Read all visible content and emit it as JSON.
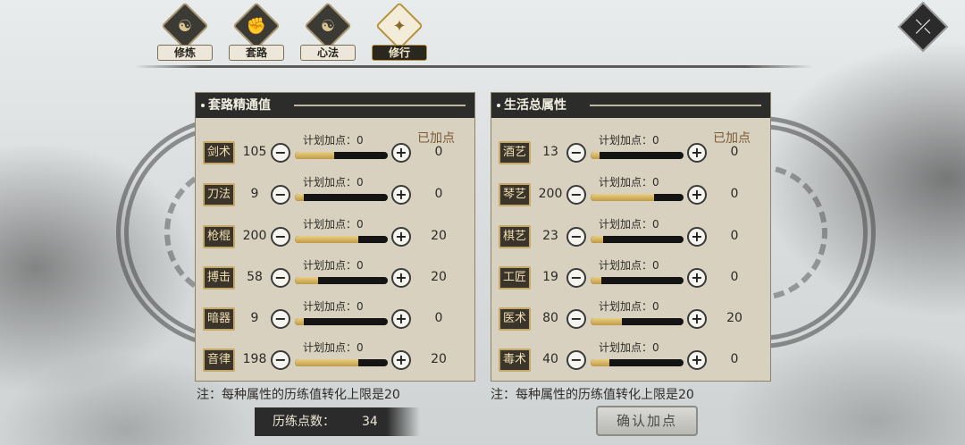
{
  "tabs": [
    {
      "label": "修炼",
      "icon": "cultivation-icon",
      "glyph": "☯",
      "active": false
    },
    {
      "label": "套路",
      "icon": "fist-icon",
      "glyph": "✊",
      "active": false
    },
    {
      "label": "心法",
      "icon": "taiji-icon",
      "glyph": "☯",
      "active": false
    },
    {
      "label": "修行",
      "icon": "practice-icon",
      "glyph": "✦",
      "active": true
    }
  ],
  "close_glyph": "⤫",
  "left_panel": {
    "title": "套路精通值",
    "added_header": "已加点",
    "plan_label": "计划加点：0",
    "rows": [
      {
        "name": "剑术",
        "value": "105",
        "added": "0",
        "fill": 0.42
      },
      {
        "name": "刀法",
        "value": "9",
        "added": "0",
        "fill": 0.1
      },
      {
        "name": "枪棍",
        "value": "200",
        "added": "20",
        "fill": 0.68
      },
      {
        "name": "搏击",
        "value": "58",
        "added": "20",
        "fill": 0.25
      },
      {
        "name": "暗器",
        "value": "9",
        "added": "0",
        "fill": 0.1
      },
      {
        "name": "音律",
        "value": "198",
        "added": "20",
        "fill": 0.68
      }
    ],
    "note": "注：每种属性的历练值转化上限是20"
  },
  "right_panel": {
    "title": "生活总属性",
    "added_header": "已加点",
    "plan_label": "计划加点：0",
    "rows": [
      {
        "name": "酒艺",
        "value": "13",
        "added": "0",
        "fill": 0.1
      },
      {
        "name": "琴艺",
        "value": "200",
        "added": "0",
        "fill": 0.68
      },
      {
        "name": "棋艺",
        "value": "23",
        "added": "0",
        "fill": 0.13
      },
      {
        "name": "工匠",
        "value": "19",
        "added": "0",
        "fill": 0.12
      },
      {
        "name": "医术",
        "value": "80",
        "added": "20",
        "fill": 0.34
      },
      {
        "name": "毒术",
        "value": "40",
        "added": "0",
        "fill": 0.2
      }
    ],
    "note": "注：每种属性的历练值转化上限是20"
  },
  "points": {
    "label": "历练点数：",
    "value": "34"
  },
  "confirm_label": "确认加点",
  "minus_glyph": "−",
  "plus_glyph": "+"
}
